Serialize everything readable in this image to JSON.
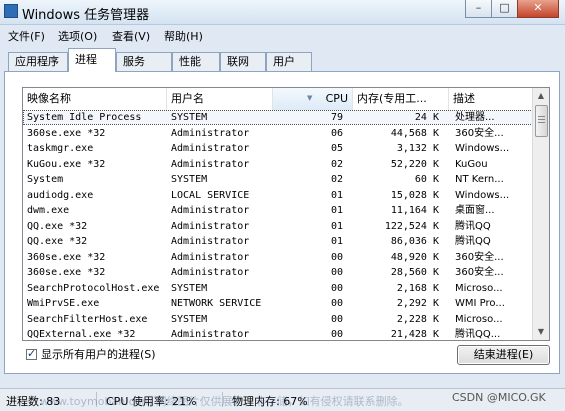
{
  "window": {
    "title": "Windows 任务管理器",
    "minimize_glyph": "–",
    "maximize_glyph": "□",
    "close_glyph": "✕"
  },
  "menu": [
    {
      "label": "文件(F)"
    },
    {
      "label": "选项(O)"
    },
    {
      "label": "查看(V)"
    },
    {
      "label": "帮助(H)"
    }
  ],
  "tabs": [
    {
      "label": "应用程序",
      "active": false
    },
    {
      "label": "进程",
      "active": true
    },
    {
      "label": "服务",
      "active": false
    },
    {
      "label": "性能",
      "active": false
    },
    {
      "label": "联网",
      "active": false
    },
    {
      "label": "用户",
      "active": false
    }
  ],
  "table": {
    "columns": [
      "映像名称",
      "用户名",
      "CPU",
      "内存(专用工...",
      "描述"
    ],
    "sorted_column": "CPU",
    "rows": [
      {
        "name": "System Idle Process",
        "user": "SYSTEM",
        "cpu": "79",
        "mem": "24 K",
        "desc": "处理器...",
        "selected": true
      },
      {
        "name": "360se.exe *32",
        "user": "Administrator",
        "cpu": "06",
        "mem": "44,568 K",
        "desc": "360安全..."
      },
      {
        "name": "taskmgr.exe",
        "user": "Administrator",
        "cpu": "05",
        "mem": "3,132 K",
        "desc": "Windows..."
      },
      {
        "name": "KuGou.exe *32",
        "user": "Administrator",
        "cpu": "02",
        "mem": "52,220 K",
        "desc": "KuGou"
      },
      {
        "name": "System",
        "user": "SYSTEM",
        "cpu": "02",
        "mem": "60 K",
        "desc": "NT Kern..."
      },
      {
        "name": "audiodg.exe",
        "user": "LOCAL SERVICE",
        "cpu": "01",
        "mem": "15,028 K",
        "desc": "Windows..."
      },
      {
        "name": "dwm.exe",
        "user": "Administrator",
        "cpu": "01",
        "mem": "11,164 K",
        "desc": "桌面窗..."
      },
      {
        "name": "QQ.exe *32",
        "user": "Administrator",
        "cpu": "01",
        "mem": "122,524 K",
        "desc": "腾讯QQ"
      },
      {
        "name": "QQ.exe *32",
        "user": "Administrator",
        "cpu": "01",
        "mem": "86,036 K",
        "desc": "腾讯QQ"
      },
      {
        "name": "360se.exe *32",
        "user": "Administrator",
        "cpu": "00",
        "mem": "48,920 K",
        "desc": "360安全..."
      },
      {
        "name": "360se.exe *32",
        "user": "Administrator",
        "cpu": "00",
        "mem": "28,560 K",
        "desc": "360安全..."
      },
      {
        "name": "SearchProtocolHost.exe",
        "user": "SYSTEM",
        "cpu": "00",
        "mem": "2,168 K",
        "desc": "Microso..."
      },
      {
        "name": "WmiPrvSE.exe",
        "user": "NETWORK SERVICE",
        "cpu": "00",
        "mem": "2,292 K",
        "desc": "WMI Pro..."
      },
      {
        "name": "SearchFilterHost.exe",
        "user": "SYSTEM",
        "cpu": "00",
        "mem": "2,228 K",
        "desc": "Microso..."
      },
      {
        "name": "QQExternal.exe *32",
        "user": "Administrator",
        "cpu": "00",
        "mem": "21,428 K",
        "desc": "腾讯QQ..."
      }
    ]
  },
  "show_all_users": {
    "label": "显示所有用户的进程(S)",
    "checked": true
  },
  "end_process_label": "结束进程(E)",
  "status": {
    "processes": "进程数: 83",
    "cpu": "CPU 使用率: 21%",
    "memory": "物理内存: 67%"
  },
  "watermark": "www.toymoban.com 网络图片仅供展示，非存储，如有侵权请联系删除。",
  "credit": "CSDN @MICO.GK"
}
